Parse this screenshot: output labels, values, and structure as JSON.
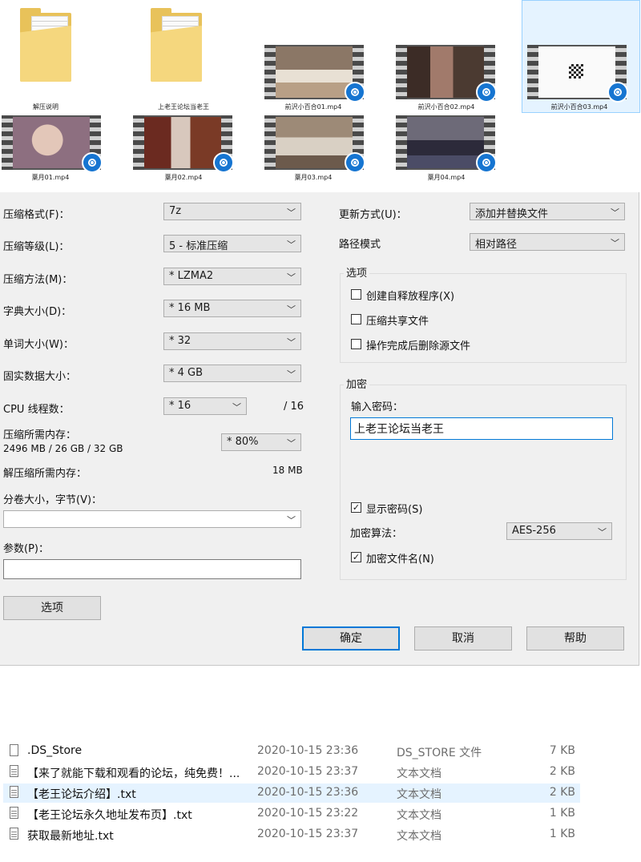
{
  "thumbnails": [
    {
      "label": "解压说明",
      "kind": "folder"
    },
    {
      "label": "上老王论坛当老王",
      "kind": "folder"
    },
    {
      "label": "前沢小百合01.mp4",
      "kind": "video"
    },
    {
      "label": "前沢小百合02.mp4",
      "kind": "video"
    },
    {
      "label": "前沢小百合03.mp4",
      "kind": "video"
    },
    {
      "label": "葉月01.mp4",
      "kind": "video"
    },
    {
      "label": "葉月02.mp4",
      "kind": "video"
    },
    {
      "label": "葉月03.mp4",
      "kind": "video"
    },
    {
      "label": "葉月04.mp4",
      "kind": "video"
    }
  ],
  "dialog": {
    "left": {
      "format_label": "压缩格式(F)：",
      "format_value": "7z",
      "level_label": "压缩等级(L)：",
      "level_value": "5 - 标准压缩",
      "method_label": "压缩方法(M)：",
      "method_value": "* LZMA2",
      "dict_label": "字典大小(D)：",
      "dict_value": "* 16 MB",
      "word_label": "单词大小(W)：",
      "word_value": "* 32",
      "solid_label": "固实数据大小：",
      "solid_value": "* 4 GB",
      "cpu_label": "CPU 线程数：",
      "cpu_value": "* 16",
      "cpu_total": "/ 16",
      "mem_label": "压缩所需内存：",
      "mem_detail": "2496 MB / 26 GB / 32 GB",
      "mem_value": "* 80%",
      "decomp_label": "解压缩所需内存：",
      "decomp_value": "18 MB",
      "split_label": "分卷大小，字节(V)：",
      "split_value": "",
      "params_label": "参数(P)：",
      "params_value": "",
      "options_button": "选项"
    },
    "right": {
      "update_label": "更新方式(U)：",
      "update_value": "添加并替换文件",
      "path_label": "路径模式",
      "path_value": "相对路径",
      "options_group": "选项",
      "sfx_label": "创建自释放程序(X)",
      "sfx_checked": false,
      "shared_label": "压缩共享文件",
      "shared_checked": false,
      "delete_label": "操作完成后删除源文件",
      "delete_checked": false,
      "encrypt_group": "加密",
      "password_label": "输入密码：",
      "password_value": "上老王论坛当老王",
      "show_pw_label": "显示密码(S)",
      "show_pw_checked": true,
      "algo_label": "加密算法：",
      "algo_value": "AES-256",
      "encrypt_names_label": "加密文件名(N)",
      "encrypt_names_checked": true
    },
    "buttons": {
      "ok": "确定",
      "cancel": "取消",
      "help": "帮助"
    }
  },
  "files": [
    {
      "name": ".DS_Store",
      "date": "2020-10-15 23:36",
      "type": "DS_STORE 文件",
      "size": "7 KB",
      "selected": false,
      "icon": "blank-file-icon"
    },
    {
      "name": "【来了就能下载和观看的论坛，纯免费！...",
      "date": "2020-10-15 23:37",
      "type": "文本文档",
      "size": "2 KB",
      "selected": false,
      "icon": "text-file-icon"
    },
    {
      "name": "【老王论坛介绍】.txt",
      "date": "2020-10-15 23:36",
      "type": "文本文档",
      "size": "2 KB",
      "selected": true,
      "icon": "text-file-icon"
    },
    {
      "name": "【老王论坛永久地址发布页】.txt",
      "date": "2020-10-15 23:22",
      "type": "文本文档",
      "size": "1 KB",
      "selected": false,
      "icon": "text-file-icon"
    },
    {
      "name": "获取最新地址.txt",
      "date": "2020-10-15 23:37",
      "type": "文本文档",
      "size": "1 KB",
      "selected": false,
      "icon": "text-file-icon"
    }
  ]
}
